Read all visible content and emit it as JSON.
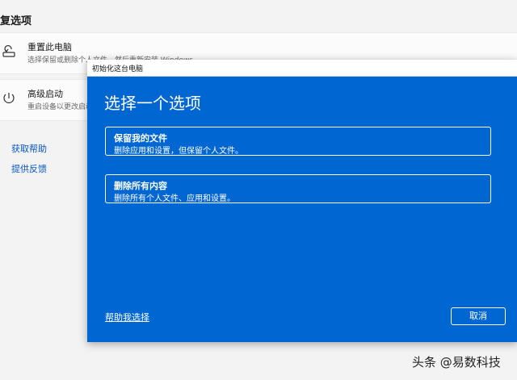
{
  "background": {
    "section_title": "复选项",
    "cards": [
      {
        "title": "重置此电脑",
        "subtitle": "选择保留或删除个人文件，然后重新安装 Windows"
      },
      {
        "title": "高级启动",
        "subtitle": "重启设备以更改启动设置"
      }
    ],
    "links": [
      {
        "label": "获取帮助"
      },
      {
        "label": "提供反馈"
      }
    ]
  },
  "dialog": {
    "window_title": "初始化这台电脑",
    "heading": "选择一个选项",
    "options": [
      {
        "title": "保留我的文件",
        "description": "删除应用和设置，但保留个人文件。"
      },
      {
        "title": "删除所有内容",
        "description": "删除所有个人文件、应用和设置。"
      }
    ],
    "help_link": "帮助我选择",
    "cancel_label": "取消"
  },
  "watermark": "头条 @易数科技",
  "colors": {
    "dialog_bg": "#0066d1",
    "accent_link": "#0b57c7"
  }
}
